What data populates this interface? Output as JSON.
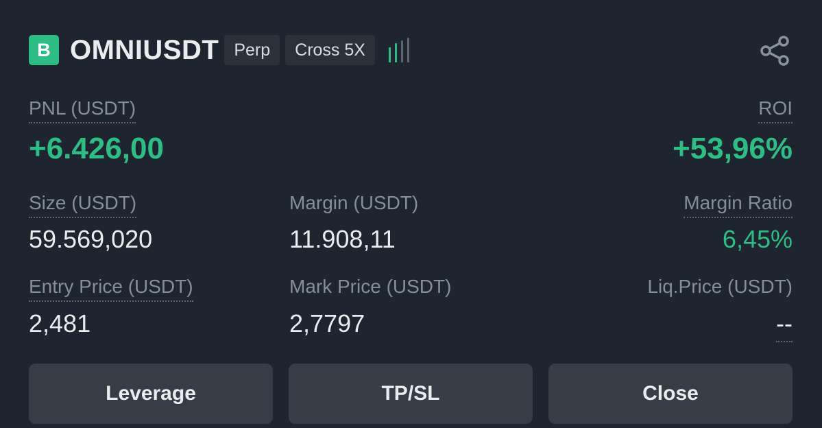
{
  "position": {
    "side_badge": "B",
    "symbol": "OMNIUSDT",
    "type_tag": "Perp",
    "margin_mode_tag": "Cross 5X",
    "risk_icon": "risk-bars-icon",
    "share_icon": "share-icon"
  },
  "pnl": {
    "label": "PNL (USDT)",
    "value": "+6.426,00"
  },
  "roi": {
    "label": "ROI",
    "value": "+53,96%"
  },
  "size": {
    "label": "Size (USDT)",
    "value": "59.569,020"
  },
  "margin": {
    "label": "Margin (USDT)",
    "value": "11.908,11"
  },
  "margin_ratio": {
    "label": "Margin Ratio",
    "value": "6,45%"
  },
  "entry_price": {
    "label": "Entry Price (USDT)",
    "value": "2,481"
  },
  "mark_price": {
    "label": "Mark Price (USDT)",
    "value": "2,7797"
  },
  "liq_price": {
    "label": "Liq.Price (USDT)",
    "value": "--"
  },
  "buttons": {
    "leverage": "Leverage",
    "tpsl": "TP/SL",
    "close": "Close"
  },
  "colors": {
    "background": "#1f2530",
    "positive": "#2ebd85",
    "muted_text": "#848e9c",
    "button_bg": "#363d47"
  }
}
